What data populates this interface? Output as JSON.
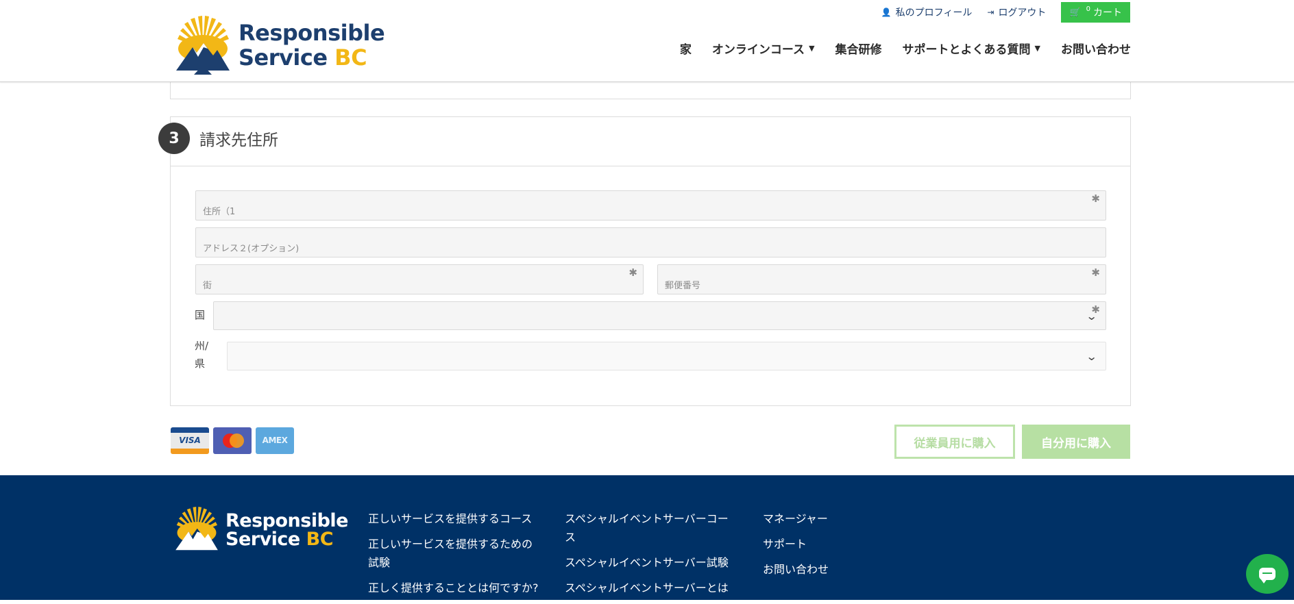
{
  "header": {
    "logo": {
      "line1": "Responsible",
      "line2": "Service",
      "accent": "BC"
    },
    "topbar": {
      "profile": "私のプロフィール",
      "logout": "ログアウト",
      "cart_count": "0",
      "cart": "カート"
    },
    "nav": [
      {
        "label": "家",
        "dropdown": false
      },
      {
        "label": "オンラインコース",
        "dropdown": true
      },
      {
        "label": "集合研修",
        "dropdown": false
      },
      {
        "label": "サポートとよくある質問",
        "dropdown": true
      },
      {
        "label": "お問い合わせ",
        "dropdown": false
      }
    ]
  },
  "billing": {
    "step": "3",
    "title": "請求先住所",
    "address1_placeholder": "住所（1",
    "address2_placeholder": "アドレス２(オプション)",
    "city_placeholder": "街",
    "postal_placeholder": "郵便番号",
    "country_label": "国",
    "state_label": "州/県",
    "required_mark": "✱"
  },
  "payment": {
    "cards": [
      "VISA",
      "Mastercard",
      "AMEX"
    ],
    "buy_employee": "従業員用に購入",
    "buy_self": "自分用に購入"
  },
  "footer": {
    "logo": {
      "line1": "Responsible",
      "line2": "Service",
      "accent": "BC"
    },
    "col1": [
      "正しいサービスを提供するコース",
      "正しいサービスを提供するための試験",
      "正しく提供することとは何ですか?"
    ],
    "col2": [
      "スペシャルイベントサーバーコース",
      "スペシャルイベントサーバー試験",
      "スペシャルイベントサーバーとは"
    ],
    "col3": [
      "マネージャー",
      "サポート",
      "お問い合わせ"
    ]
  },
  "colors": {
    "brand_navy": "#1d3f6e",
    "brand_gold": "#f2b716",
    "cart_green": "#37c24a",
    "buy_green": "#b7e0a3",
    "footer_bg": "#003166"
  }
}
